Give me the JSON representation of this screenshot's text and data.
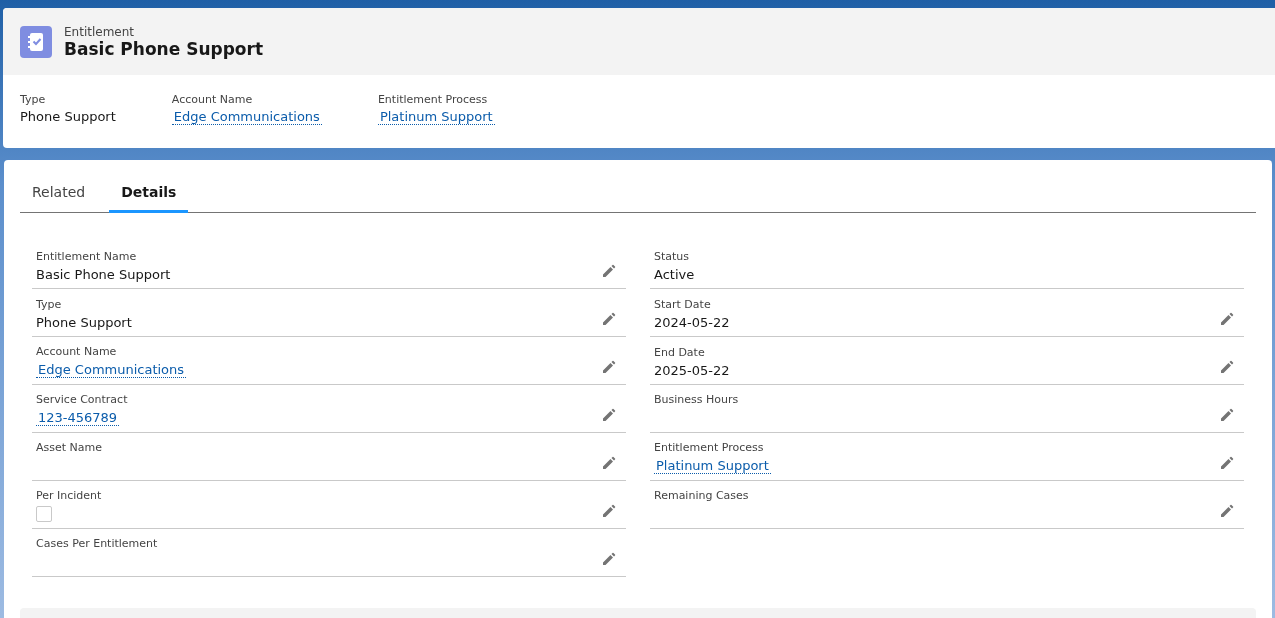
{
  "header": {
    "object_type": "Entitlement",
    "title": "Basic Phone Support",
    "highlights": [
      {
        "label": "Type",
        "value": "Phone Support",
        "kind": "text"
      },
      {
        "label": "Account Name",
        "value": "Edge Communications",
        "kind": "link"
      },
      {
        "label": "Entitlement Process",
        "value": "Platinum Support",
        "kind": "link"
      }
    ]
  },
  "tabs": [
    {
      "label": "Related",
      "selected": false
    },
    {
      "label": "Details",
      "selected": true
    }
  ],
  "details": {
    "left": [
      {
        "label": "Entitlement Name",
        "value": "Basic Phone Support",
        "kind": "text",
        "editable": true
      },
      {
        "label": "Type",
        "value": "Phone Support",
        "kind": "text",
        "editable": true
      },
      {
        "label": "Account Name",
        "value": "Edge Communications",
        "kind": "link",
        "editable": true
      },
      {
        "label": "Service Contract",
        "value": "123-456789",
        "kind": "link",
        "editable": true
      },
      {
        "label": "Asset Name",
        "kind": "text",
        "editable": true
      },
      {
        "label": "Per Incident",
        "kind": "checkbox",
        "checked": false,
        "editable": true
      },
      {
        "label": "Cases Per Entitlement",
        "kind": "text",
        "editable": true
      }
    ],
    "right": [
      {
        "label": "Status",
        "value": "Active",
        "kind": "text",
        "editable": false
      },
      {
        "label": "Start Date",
        "value": "2024-05-22",
        "kind": "text",
        "editable": true
      },
      {
        "label": "End Date",
        "value": "2025-05-22",
        "kind": "text",
        "editable": true
      },
      {
        "label": "Business Hours",
        "kind": "text",
        "editable": true
      },
      {
        "label": "Entitlement Process",
        "value": "Platinum Support",
        "kind": "link",
        "editable": true
      },
      {
        "label": "Remaining Cases",
        "kind": "text",
        "editable": true
      }
    ]
  }
}
